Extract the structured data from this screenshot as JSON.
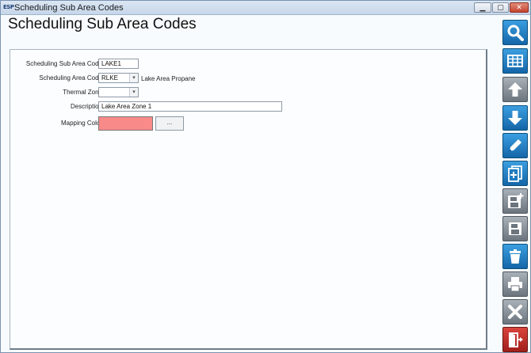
{
  "window": {
    "app_icon_text": "ESP",
    "title": "Scheduling Sub Area Codes",
    "min_label": "▁",
    "max_label": "▢",
    "close_label": "✕"
  },
  "page": {
    "title": "Scheduling Sub Area Codes"
  },
  "form": {
    "sub_area_code": {
      "label": "Scheduling Sub Area Code",
      "value": "LAKE1"
    },
    "area_code": {
      "label": "Scheduling Area Code",
      "value": "RLKE",
      "description": "Lake Area Propane"
    },
    "thermal_zone": {
      "label": "Thermal Zone",
      "value": ""
    },
    "description": {
      "label": "Description",
      "value": "Lake Area Zone 1"
    },
    "mapping_color": {
      "label": "Mapping Color",
      "color": "#f88a8a",
      "button_label": "..."
    }
  },
  "toolbar": [
    {
      "name": "search-button",
      "icon": "search-icon",
      "style": "blue"
    },
    {
      "name": "grid-view-button",
      "icon": "grid-icon",
      "style": "blue"
    },
    {
      "name": "previous-record-button",
      "icon": "arrow-up-icon",
      "style": "gray"
    },
    {
      "name": "next-record-button",
      "icon": "arrow-down-icon",
      "style": "blue"
    },
    {
      "name": "edit-button",
      "icon": "pencil-icon",
      "style": "blue"
    },
    {
      "name": "new-record-button",
      "icon": "new-document-icon",
      "style": "blue"
    },
    {
      "name": "save-new-button",
      "icon": "floppy-plus-icon",
      "style": "gray"
    },
    {
      "name": "save-button",
      "icon": "floppy-icon",
      "style": "gray"
    },
    {
      "name": "delete-button",
      "icon": "trash-icon",
      "style": "blue"
    },
    {
      "name": "print-button",
      "icon": "printer-icon",
      "style": "gray"
    },
    {
      "name": "cancel-button",
      "icon": "x-icon",
      "style": "gray"
    },
    {
      "name": "exit-button",
      "icon": "exit-door-icon",
      "style": "red"
    }
  ]
}
